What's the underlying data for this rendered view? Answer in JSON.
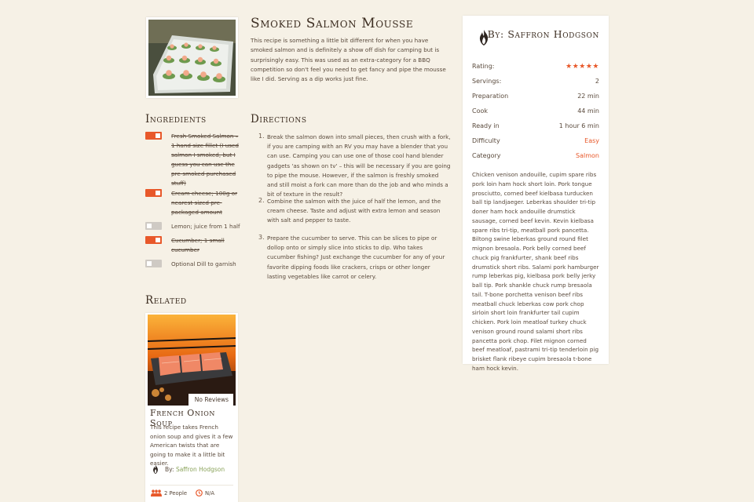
{
  "recipe": {
    "title": "Smoked Salmon Mousse",
    "intro": "This recipe is something a little bit different for when you have smoked salmon and is definitely a show off dish for camping but is surprisingly easy. This was used as an extra-category for a BBQ competition so don't feel you need to get fancy and pipe the mousse like I did. Serving as a dip works just fine.",
    "photo_alt": "Smoked salmon mousse served on cucumber slices"
  },
  "ingredients": {
    "heading": "Ingredients",
    "items": [
      {
        "label": "Fresh Smoked Salmon – 1 hand size fillet (I used salmon I smoked, but I guess you can use the pre-smoked purchased stuff)",
        "checked": true
      },
      {
        "label": "Cream cheese; 100g or nearest sized pre-packaged amount",
        "checked": true
      },
      {
        "label": "Lemon; juice from 1 half",
        "checked": false
      },
      {
        "label": "Cucumber; 1 small cucumber",
        "checked": true
      },
      {
        "label": "Optional Dill to garnish",
        "checked": false
      }
    ]
  },
  "directions": {
    "heading": "Directions",
    "steps": [
      {
        "num": "1.",
        "text": "Break the salmon down into small pieces, then crush with a fork, if you are camping with an RV you may have a blender that you can use. Camping you can use one of those cool hand blender gadgets 'as shown on tv' – this will be necessary if you are going to pipe the mouse. However, if the salmon is freshly smoked and still moist a fork can more than do the job and who minds a bit of texture in the result?"
      },
      {
        "num": "2.",
        "text": "Combine the salmon with the juice of half the lemon, and the cream cheese. Taste and adjust with extra lemon and season with salt and pepper to taste."
      },
      {
        "num": "3.",
        "text": "Prepare the cucumber to serve. This can be slices to pipe or dollop onto or simply slice into sticks to dip. Who takes cucumber fishing? Just exchange the cucumber for any of your favorite dipping foods like crackers, crisps or other longer lasting vegetables like carrot or celery."
      }
    ]
  },
  "sidebar": {
    "author": "By: Saffron Hodgson",
    "rating_label": "Rating:",
    "rating_stars": "★★★★★",
    "rating_value": 5,
    "servings_label": "Servings:",
    "servings_value": "2",
    "preparation_label": "Preparation",
    "preparation_value": "22 min",
    "cook_label": "Cook",
    "cook_value": "44 min",
    "ready_label": "Ready in",
    "ready_value": "1 hour 6 min",
    "difficulty_label": "Difficulty",
    "difficulty_value": "Easy",
    "category_label": "Category",
    "category_value": "Salmon",
    "body": "Chicken venison andouille, cupim spare ribs pork loin ham hock short loin. Pork tongue prosciutto, corned beef kielbasa turducken ball tip landjaeger. Leberkas shoulder tri-tip doner ham hock andouille drumstick sausage, corned beef kevin. Kevin kielbasa spare ribs tri-tip, meatball pork pancetta. Biltong swine leberkas ground round filet mignon bresaola. Pork belly corned beef chuck pig frankfurter, shank beef ribs drumstick short ribs. Salami pork hamburger rump leberkas pig, kielbasa pork belly jerky ball tip. Pork shankle chuck rump bresaola tail. T-bone porchetta venison beef ribs meatball chuck leberkas cow pork chop sirloin short loin frankfurter tail cupim chicken. Pork loin meatloaf turkey chuck venison ground round salami short ribs pancetta pork chop. Filet mignon corned beef meatloaf, pastrami tri-tip tenderloin pig brisket flank ribeye cupim bresaola t-bone ham hock kevin."
  },
  "related": {
    "heading": "Related",
    "card": {
      "reviews": "No Reviews",
      "title": "French Onion Soup",
      "description": "This recipe takes French onion soup and gives it a few American twists that are going to make it a little bit easier.",
      "by_prefix": "By: ",
      "author": "Saffron Hodgson",
      "people": "2 People",
      "time": "N/A"
    }
  },
  "colors": {
    "accent": "#e8582a",
    "background": "#f6f1e6",
    "link_green": "#8aa35a",
    "toggle_off": "#cfcac4"
  },
  "icons": [
    "flame-logo-icon",
    "star-icon",
    "people-icon",
    "clock-icon"
  ]
}
